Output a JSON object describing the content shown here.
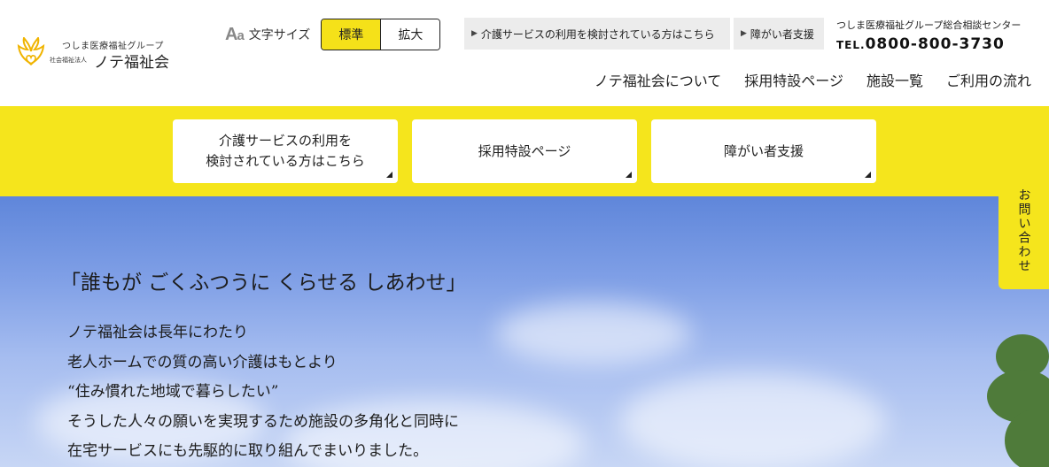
{
  "header": {
    "logo": {
      "group": "つしま医療福祉グループ",
      "corp_type": "社会福祉法人",
      "name": "ノテ福祉会"
    },
    "font_size": {
      "icon": "Aa",
      "label": "文字サイズ",
      "standard": "標準",
      "large": "拡大",
      "active_color": "#f5e119"
    },
    "quick_links": [
      {
        "label": "介護サービスの利用を検討されている方はこちら"
      },
      {
        "label": "障がい者支援"
      }
    ],
    "contact": {
      "center": "つしま医療福祉グループ総合相談センター",
      "tel_prefix": "TEL.",
      "tel": "0800-800-3730"
    },
    "nav": [
      "ノテ福祉会について",
      "採用特設ページ",
      "施設一覧",
      "ご利用の流れ"
    ]
  },
  "band": {
    "color": "#f5e51c",
    "cards": [
      {
        "line1": "介護サービスの利用を",
        "line2": "検討されている方はこちら"
      },
      {
        "line1": "採用特設ページ"
      },
      {
        "line1": "障がい者支援"
      }
    ]
  },
  "hero": {
    "title": "「誰もが ごくふつうに くらせる しあわせ」",
    "body": [
      "ノテ福祉会は長年にわたり",
      "老人ホームでの質の高い介護はもとより",
      "“住み慣れた地域で暮らしたい”",
      "そうした人々の願いを実現するため施設の多角化と同時に",
      "在宅サービスにも先駆的に取り組んでまいりました。"
    ]
  },
  "inquiry_tab": {
    "label": "お問い合わせ"
  }
}
